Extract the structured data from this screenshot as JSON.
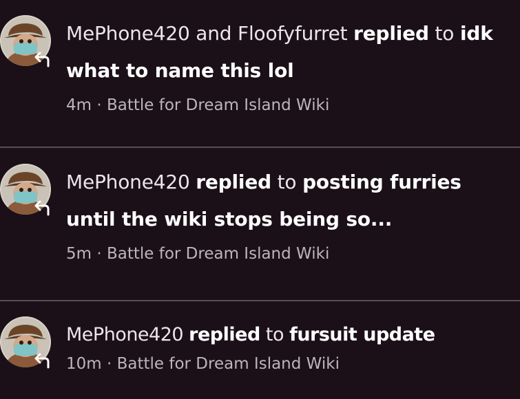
{
  "colors": {
    "background": "#1c1018",
    "divider": "#5a4c55",
    "primary_text": "#ece6ea",
    "meta_text": "#bdb5bb"
  },
  "notifications": [
    {
      "icon": "reply-arrow-icon",
      "actor": "MePhone420 and Floofyfurret",
      "verb": "replied",
      "preposition": "to",
      "thread_title": "idk what to name this lol",
      "time": "4m",
      "separator": "·",
      "wiki": "Battle for Dream Island Wiki"
    },
    {
      "icon": "reply-arrow-icon",
      "actor": "MePhone420",
      "verb": "replied",
      "preposition": "to",
      "thread_title": "posting furries until the wiki stops being so...",
      "time": "5m",
      "separator": "·",
      "wiki": "Battle for Dream Island Wiki"
    },
    {
      "icon": "reply-arrow-icon",
      "actor": "MePhone420",
      "verb": "replied",
      "preposition": "to",
      "thread_title": "fursuit update",
      "time": "10m",
      "separator": "·",
      "wiki": "Battle for Dream Island Wiki"
    }
  ]
}
